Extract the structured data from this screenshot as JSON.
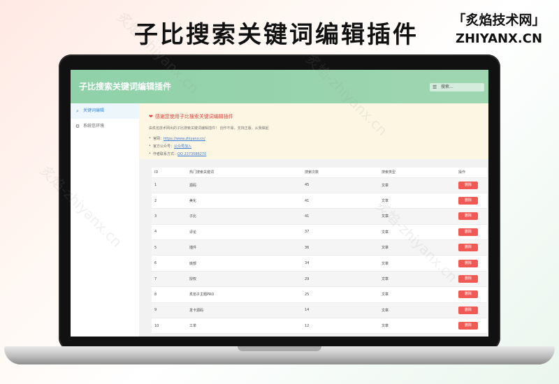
{
  "banner": {
    "title": "子比搜索关键词编辑插件",
    "brand_cn": "「炙焰技术网」",
    "brand_en": "ZHIYANX.CN"
  },
  "app": {
    "title": "子比搜索关键词编辑插件",
    "search_placeholder": "搜索..."
  },
  "sidebar": {
    "items": [
      {
        "label": "关键词编辑",
        "icon": "search-icon",
        "active": true
      },
      {
        "label": "系统信环境",
        "icon": "settings-icon",
        "active": false
      }
    ]
  },
  "notice": {
    "title": "感谢您使用子比搜索关键词编辑插件",
    "desc": "由炙焰技术网出的子比搜索关键词编辑插件！ 创作不易，支持正版，从我做起",
    "homepage_label": "官网：",
    "homepage_link": "https://www.zhiyanx.cn/",
    "wechat_label": "官方公众号：",
    "wechat_link": "公众号加入",
    "contact_label": "作者联系方式：",
    "contact_link": "QQ 2373586270"
  },
  "table": {
    "headers": [
      "ID",
      "热门搜索关键词",
      "搜索次数",
      "搜索类型",
      "操作"
    ],
    "delete_label": "删除",
    "rows": [
      {
        "id": "1",
        "keyword": "源码",
        "count": "45",
        "type": "文章"
      },
      {
        "id": "2",
        "keyword": "美化",
        "count": "41",
        "type": "文章"
      },
      {
        "id": "3",
        "keyword": "子比",
        "count": "41",
        "type": "文章"
      },
      {
        "id": "4",
        "keyword": "评论",
        "count": "37",
        "type": "文章"
      },
      {
        "id": "5",
        "keyword": "插件",
        "count": "36",
        "type": "文章"
      },
      {
        "id": "6",
        "keyword": "底部",
        "count": "34",
        "type": "文章"
      },
      {
        "id": "7",
        "keyword": "授权",
        "count": "29",
        "type": "文章"
      },
      {
        "id": "8",
        "keyword": "炙焰子主题PRO",
        "count": "25",
        "type": "文章"
      },
      {
        "id": "9",
        "keyword": "发卡源码",
        "count": "14",
        "type": "文章"
      },
      {
        "id": "10",
        "keyword": "工单",
        "count": "12",
        "type": "文章"
      }
    ]
  },
  "colors": {
    "header_green": "#8fd1a9",
    "delete_red": "#f05a55",
    "notice_bg": "#fdf6e2",
    "notice_red": "#e0433f"
  }
}
